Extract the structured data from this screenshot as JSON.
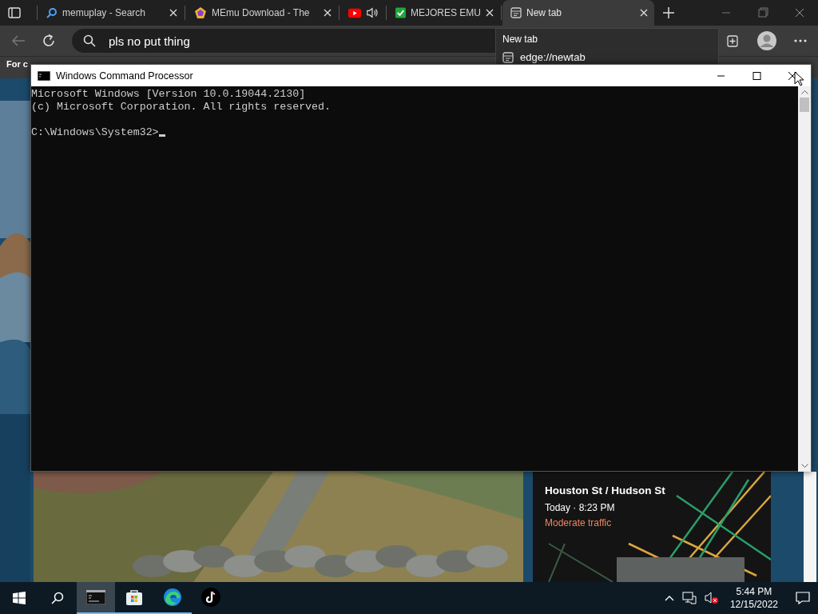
{
  "browser": {
    "tabs": [
      {
        "kind": "search",
        "title": "memuplay - Search",
        "selected": false,
        "audio": false
      },
      {
        "kind": "pentagon",
        "title": "MEmu Download - The",
        "selected": false,
        "audio": false
      },
      {
        "kind": "video",
        "selected": false,
        "audio": true
      },
      {
        "kind": "check",
        "title": "MEJORES EMU",
        "selected": false,
        "audio": false
      },
      {
        "kind": "page",
        "title": "New tab",
        "selected": true,
        "audio": false
      }
    ],
    "address": "pls no put thing",
    "tab_preview": {
      "title": "New tab",
      "url": "edge://newtab"
    },
    "favorites_bar": [
      "For c"
    ],
    "traffic_card": {
      "route": "Houston St / Hudson St",
      "time": "Today · 8:23 PM",
      "status": "Moderate traffic"
    }
  },
  "console": {
    "title": "Windows Command Processor",
    "output": [
      "Microsoft Windows [Version 10.0.19044.2130]",
      "(c) Microsoft Corporation. All rights reserved."
    ],
    "prompt": "C:\\Windows\\System32>"
  },
  "taskbar": {
    "apps": [
      {
        "kind": "terminal",
        "selected": true,
        "open": true
      },
      {
        "kind": "store",
        "selected": false,
        "open": true
      },
      {
        "kind": "edge",
        "selected": false,
        "open": true
      },
      {
        "kind": "note",
        "selected": false,
        "open": false
      }
    ],
    "time": "5:44 PM",
    "date": "12/15/2022"
  }
}
